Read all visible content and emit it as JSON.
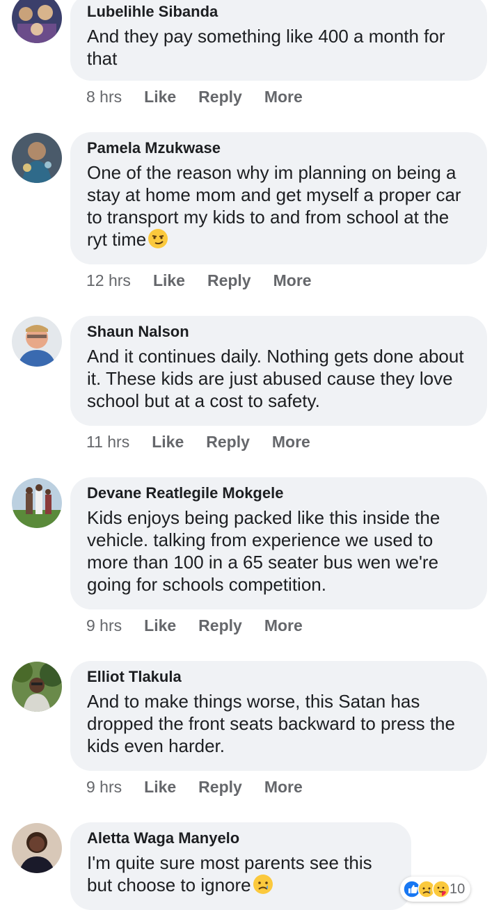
{
  "comments": [
    {
      "author": "Lubelihle Sibanda",
      "text": "And they pay something like 400 a month for that",
      "time": "8 hrs",
      "like": "Like",
      "reply": "Reply",
      "more": "More"
    },
    {
      "author": "Pamela Mzukwase",
      "text": "One of the reason why im planning on being a stay at home mom and get myself a proper car to transport my kids to and from school at the ryt time",
      "emoji": "smirk-emoji",
      "time": "12 hrs",
      "like": "Like",
      "reply": "Reply",
      "more": "More"
    },
    {
      "author": "Shaun Nalson",
      "text": "And it continues daily. Nothing gets done about it. These kids are just abused cause they love school but at a cost to safety.",
      "time": "11 hrs",
      "like": "Like",
      "reply": "Reply",
      "more": "More"
    },
    {
      "author": "Devane Reatlegile Mokgele",
      "text": "Kids enjoys being packed like this inside the vehicle. talking from experience we used to more than 100 in a 65 seater bus wen we're going for schools competition.",
      "time": "9 hrs",
      "like": "Like",
      "reply": "Reply",
      "more": "More"
    },
    {
      "author": "Elliot Tlakula",
      "text": "And to make things worse, this Satan has dropped the front seats backward to press the kids even harder.",
      "time": "9 hrs",
      "like": "Like",
      "reply": "Reply",
      "more": "More"
    },
    {
      "author": "Aletta Waga Manyelo",
      "text": "I'm quite sure most parents see this but choose to ignore",
      "emoji": "sad-emoji",
      "reaction_icons": [
        "like-reaction-icon",
        "sad-reaction-icon",
        "care-reaction-icon"
      ],
      "reaction_count": "10"
    }
  ],
  "colors": {
    "bubble": "#f0f2f5",
    "meta": "#65676b",
    "text": "#1c1e21",
    "like_blue": "#1877f2",
    "emoji_yellow": "#fbc93d"
  }
}
